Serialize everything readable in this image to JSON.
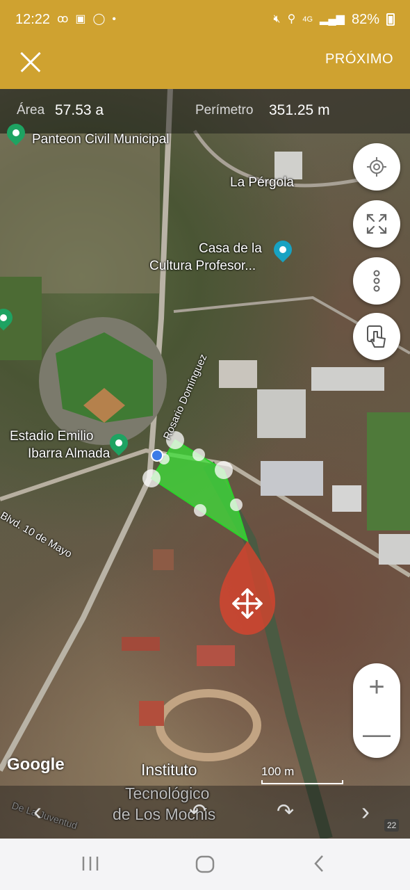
{
  "status": {
    "time": "12:22",
    "battery": "82%",
    "network": "4G"
  },
  "appbar": {
    "close_icon": "close-icon",
    "next_label": "PRÓXIMO"
  },
  "measure": {
    "area_label": "Área",
    "area_value": "57.53 a",
    "perimeter_label": "Perímetro",
    "perimeter_value": "351.25 m"
  },
  "map": {
    "places": {
      "panteon": "Panteon Civil Municipal",
      "pergola": "La Pérgola",
      "casa_line1": "Casa de la",
      "casa_line2": "Cultura Profesor...",
      "estadio_line1": "Estadio Emilio",
      "estadio_line2": "Ibarra Almada",
      "instituto_line1": "Instituto",
      "instituto_line2": "Tecnológico",
      "instituto_line3": "de Los Mochis"
    },
    "streets": {
      "blvd": "Blvd. 10 de Mayo",
      "rosario": "Rosario Domínguez",
      "juventud": "De La Juventud"
    },
    "attribution": "Google",
    "scale": "100 m",
    "page_badge": "22",
    "polygon_color": "#3de03a",
    "handle_color": "#e0432c",
    "accent": "#cfa230"
  },
  "controls": {
    "locate_icon": "crosshair-icon",
    "fullscreen_icon": "expand-icon",
    "more_icon": "more-vertical-icon",
    "touch_icon": "hand-pointer-icon",
    "zoom_in": "+",
    "zoom_out": "—"
  }
}
